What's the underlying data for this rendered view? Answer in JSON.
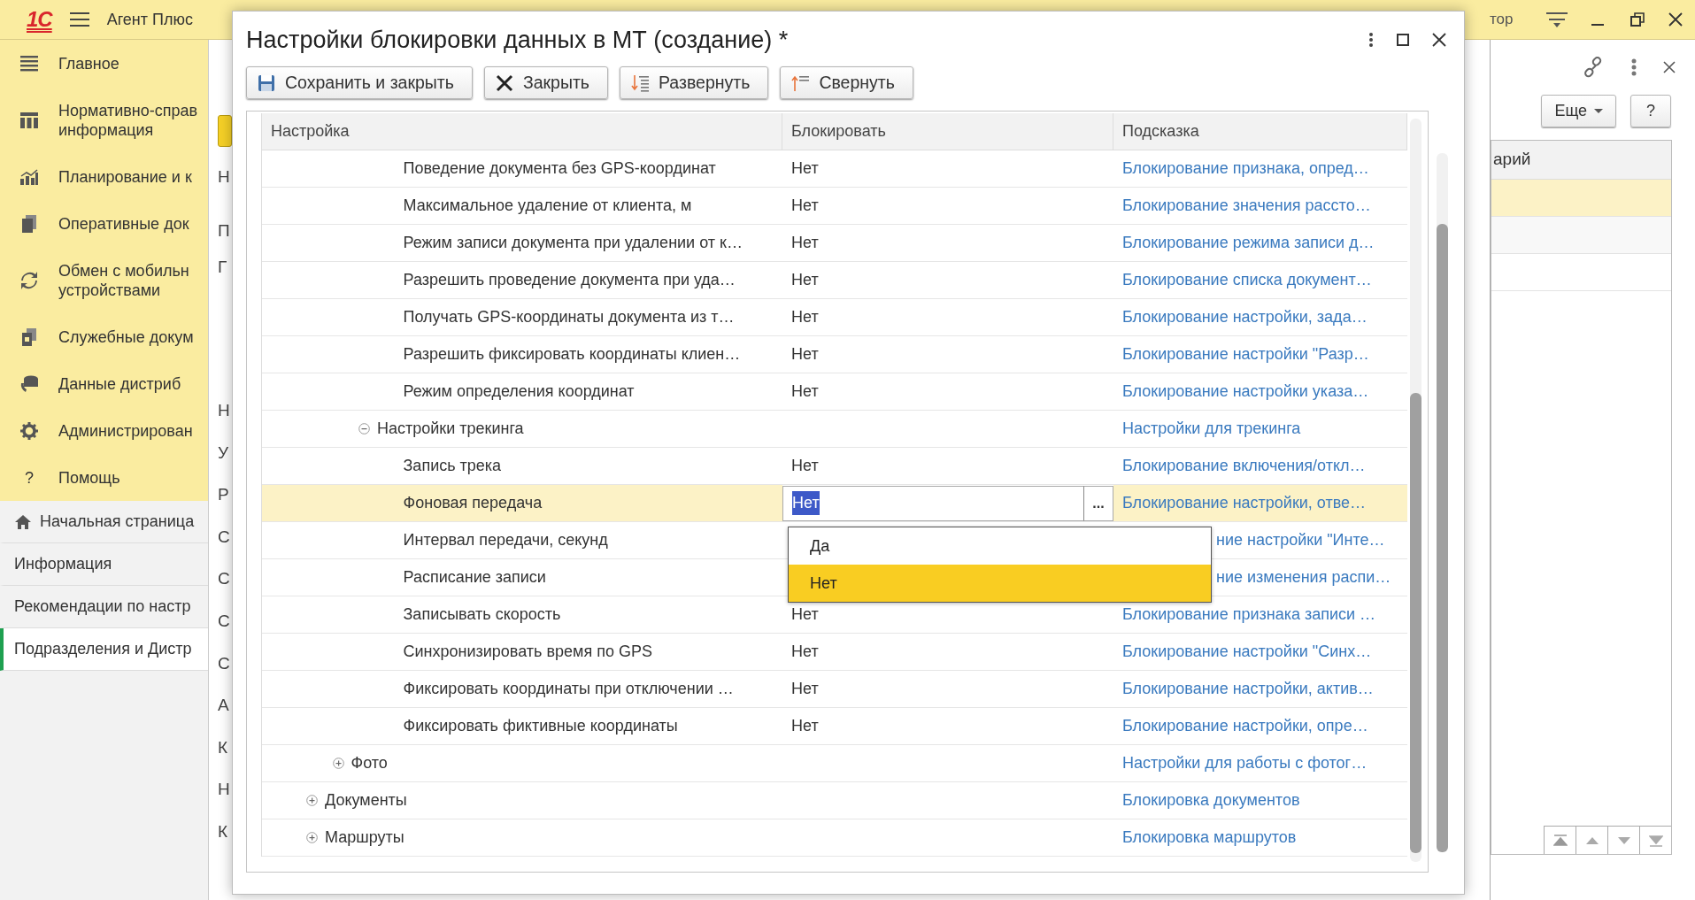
{
  "app": {
    "logo": "1С",
    "title": "Агент Плюс",
    "user_fragment": "тор"
  },
  "sidebar": {
    "sections": [
      {
        "label": "Главное"
      },
      {
        "label": "Нормативно-справ\nинформация"
      },
      {
        "label": "Планирование и к"
      },
      {
        "label": "Оперативные док"
      },
      {
        "label": "Обмен с мобильн\nустройствами"
      },
      {
        "label": "Служебные докум"
      },
      {
        "label": "Данные дистриб"
      },
      {
        "label": "Администрирован"
      },
      {
        "label": "Помощь",
        "icon_char": "?"
      }
    ],
    "open_pages": [
      {
        "label": "Начальная страница",
        "home": true,
        "selected": false
      },
      {
        "label": "Информация",
        "selected": false
      },
      {
        "label": "Рекомендации по настр",
        "selected": false
      },
      {
        "label": "Подразделения и Дистр",
        "selected": true
      }
    ]
  },
  "background_form": {
    "label_fragments": [
      [
        "Н"
      ],
      [
        "П",
        "Г"
      ],
      [
        "Н",
        "У",
        "Р",
        "С",
        "С",
        "С",
        "С",
        "А",
        "К",
        "Н",
        "К"
      ]
    ]
  },
  "right_panel": {
    "buttons": [
      {
        "label": "Еще",
        "dropdown": true
      },
      {
        "label": "?",
        "dropdown": false
      }
    ],
    "table": {
      "columns": [
        "арий"
      ],
      "rows": [
        {
          "selected": true
        },
        {
          "selected": false
        },
        {
          "selected": false
        }
      ]
    }
  },
  "dialog": {
    "title": "Настройки блокировки данных в МТ (создание) *",
    "toolbar": [
      {
        "label": "Сохранить и закрыть"
      },
      {
        "label": "Закрыть"
      },
      {
        "label": "Развернуть"
      },
      {
        "label": "Свернуть"
      }
    ],
    "table": {
      "columns": [
        "Настройка",
        "Блокировать",
        "Подсказка"
      ],
      "tree": [
        {
          "children": [
            {
              "children": [
                {
                  "children": [
                    {
                      "label": "Поведение документа без GPS-координат",
                      "value": "Нет",
                      "hint": "Блокирование признака, опред…",
                      "selected": false
                    },
                    {
                      "label": "Максимальное удаление от клиента, м",
                      "value": "Нет",
                      "hint": "Блокирование значения рассто…",
                      "selected": false
                    },
                    {
                      "label": "Режим записи документа при удалении от к…",
                      "value": "Нет",
                      "hint": "Блокирование режима записи д…",
                      "selected": false
                    },
                    {
                      "label": "Разрешить проведение документа при уда…",
                      "value": "Нет",
                      "hint": "Блокирование списка документ…",
                      "selected": false
                    },
                    {
                      "label": "Получать GPS-координаты документа из т…",
                      "value": "Нет",
                      "hint": "Блокирование настройки, зада…",
                      "selected": false
                    },
                    {
                      "label": "Разрешить фиксировать координаты клиен…",
                      "value": "Нет",
                      "hint": "Блокирование настройки \"Разр…",
                      "selected": false
                    },
                    {
                      "label": "Режим определения координат",
                      "value": "Нет",
                      "hint": "Блокирование настройки указа…",
                      "selected": false
                    }
                  ]
                },
                {
                  "label": "Настройки трекинга",
                  "hint": "Настройки для трекинга",
                  "expanded": true,
                  "selected": false,
                  "children": [
                    {
                      "label": "Запись трека",
                      "value": "Нет",
                      "hint": "Блокирование включения/откл…",
                      "selected": false
                    },
                    {
                      "label": "Фоновая передача",
                      "value": "Нет",
                      "choice_button": "...",
                      "hint": "Блокирование настройки, отве…",
                      "selected": true
                    },
                    {
                      "label": "Интервал передачи, секунд",
                      "hint": "ние настройки \"Инте…",
                      "under_popup": true,
                      "selected": false
                    },
                    {
                      "label": "Расписание записи",
                      "hint": "ние изменения распи…",
                      "under_popup": true,
                      "selected": false
                    },
                    {
                      "label": "Записывать скорость",
                      "value": "Нет",
                      "hint": "Блокирование признака записи …",
                      "selected": false
                    },
                    {
                      "label": "Синхронизировать время по GPS",
                      "value": "Нет",
                      "hint": "Блокирование настройки \"Синх…",
                      "selected": false
                    },
                    {
                      "label": "Фиксировать координаты при отключении …",
                      "value": "Нет",
                      "hint": "Блокирование настройки, актив…",
                      "selected": false
                    },
                    {
                      "label": "Фиксировать фиктивные координаты",
                      "value": "Нет",
                      "hint": "Блокирование настройки, опре…",
                      "selected": false
                    }
                  ]
                }
              ]
            },
            {
              "label": "Фото",
              "hint": "Настройки для работы с фотог…",
              "expanded": false,
              "selected": false
            }
          ]
        },
        {
          "label": "Документы",
          "hint": "Блокировка документов",
          "expanded": false,
          "selected": false
        },
        {
          "label": "Маршруты",
          "hint": "Блокировка маршрутов",
          "expanded": false,
          "selected": false
        }
      ]
    },
    "popup": {
      "items": [
        {
          "label": "Да",
          "selected": false
        },
        {
          "label": "Нет",
          "selected": true
        }
      ]
    }
  }
}
